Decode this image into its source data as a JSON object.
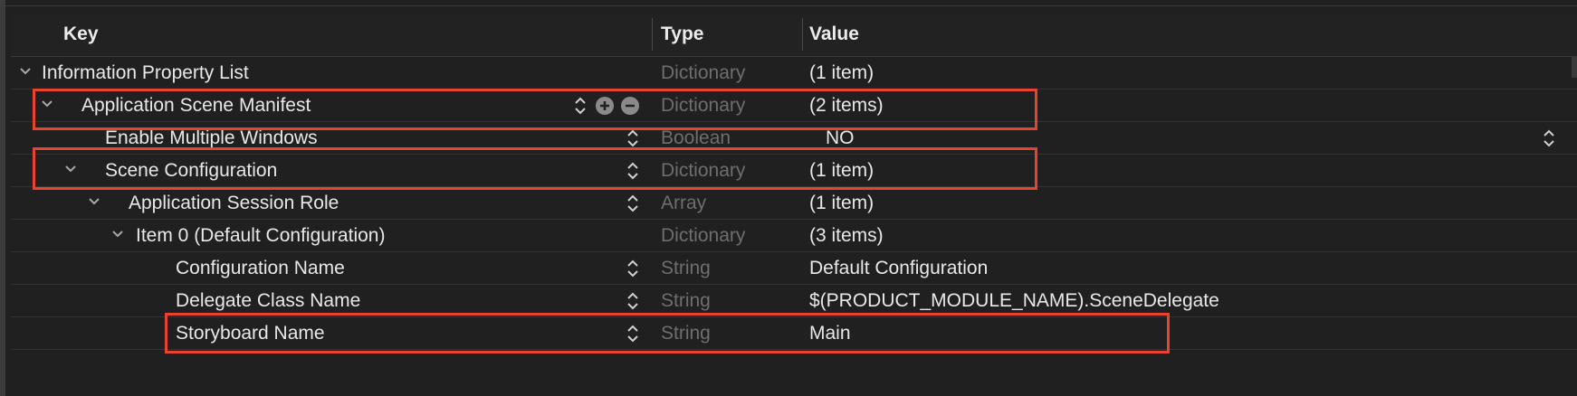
{
  "columns": {
    "key": "Key",
    "type": "Type",
    "value": "Value"
  },
  "rows": [
    {
      "key": "Information Property List",
      "type": "Dictionary",
      "value": "(1 item)"
    },
    {
      "key": "Application Scene Manifest",
      "type": "Dictionary",
      "value": "(2 items)"
    },
    {
      "key": "Enable Multiple Windows",
      "type": "Boolean",
      "value": "NO"
    },
    {
      "key": "Scene Configuration",
      "type": "Dictionary",
      "value": "(1 item)"
    },
    {
      "key": "Application Session Role",
      "type": "Array",
      "value": "(1 item)"
    },
    {
      "key": "Item 0 (Default Configuration)",
      "type": "Dictionary",
      "value": "(3 items)"
    },
    {
      "key": "Configuration Name",
      "type": "String",
      "value": "Default Configuration"
    },
    {
      "key": "Delegate Class Name",
      "type": "String",
      "value": "$(PRODUCT_MODULE_NAME).SceneDelegate"
    },
    {
      "key": "Storyboard Name",
      "type": "String",
      "value": "Main"
    }
  ],
  "colors": {
    "background": "#202020",
    "text": "#e8e8e8",
    "type_text": "#6e6e6e",
    "highlight": "#e8432f"
  },
  "icons": {
    "disclosure": "chevron-down-icon",
    "stepper": "up-down-stepper-icon",
    "add": "plus-circle-icon",
    "remove": "minus-circle-icon"
  }
}
